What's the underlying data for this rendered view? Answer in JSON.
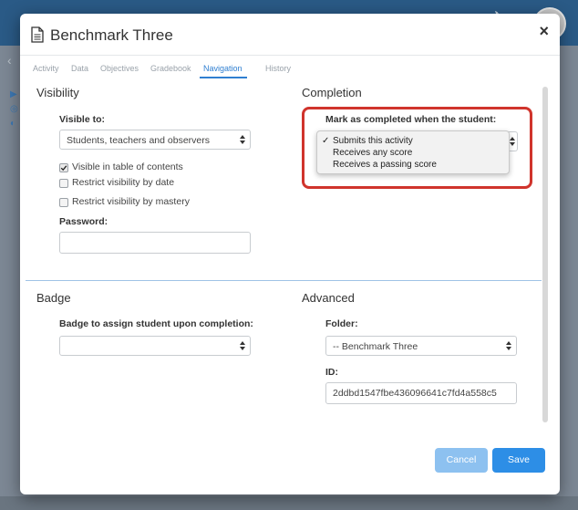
{
  "modal": {
    "title": "Benchmark Three",
    "close_label": "×"
  },
  "tabs": [
    {
      "label": "Activity"
    },
    {
      "label": "Data"
    },
    {
      "label": "Objectives"
    },
    {
      "label": "Gradebook"
    },
    {
      "label": "Navigation",
      "active": true
    },
    {
      "label": "History"
    }
  ],
  "visibility": {
    "title": "Visibility",
    "visible_to_label": "Visible to:",
    "visible_to_value": "Students, teachers and observers",
    "options": [
      {
        "label": "Visible in table of contents",
        "checked": true
      },
      {
        "label": "Restrict visibility by date",
        "checked": false
      },
      {
        "label": "Restrict visibility by mastery",
        "checked": false
      }
    ],
    "password_label": "Password:",
    "password_value": ""
  },
  "completion": {
    "title": "Completion",
    "mark_label": "Mark as completed when the student:",
    "dropdown_options": [
      {
        "label": "Submits this activity",
        "selected": true
      },
      {
        "label": "Receives any score",
        "selected": false
      },
      {
        "label": "Receives a passing score",
        "selected": false
      }
    ],
    "check_glyph": "✓"
  },
  "badge": {
    "title": "Badge",
    "assign_label": "Badge to assign student upon completion:",
    "assign_value": ""
  },
  "advanced": {
    "title": "Advanced",
    "folder_label": "Folder:",
    "folder_value": "-- Benchmark Three",
    "id_label": "ID:",
    "id_value": "2ddbd1547fbe436096641c7fd4a558c5"
  },
  "buttons": {
    "cancel": "Cancel",
    "save": "Save"
  },
  "colors": {
    "accent": "#2d8ee6",
    "highlight": "#d0342c"
  }
}
